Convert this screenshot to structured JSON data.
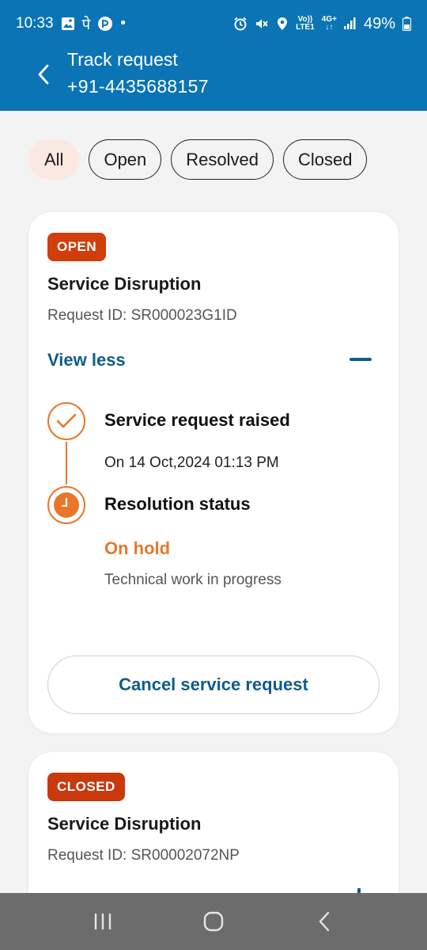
{
  "status_bar": {
    "time": "10:33",
    "pe_glyph": "पे",
    "dot": "•",
    "lte_top": "Vo))",
    "lte_bottom": "LTE1",
    "net_top": "4G+",
    "net_bottom": "↓↑",
    "battery": "49%",
    "icons": [
      "gallery-icon",
      "pe-icon",
      "phonepe-icon",
      "alarm-icon",
      "mute-icon",
      "location-icon",
      "signal-icon",
      "battery-icon"
    ]
  },
  "header": {
    "title": "Track request",
    "subtitle": "+91-4435688157",
    "background": "#0a74b5"
  },
  "filters": [
    {
      "label": "All",
      "active": true
    },
    {
      "label": "Open",
      "active": false
    },
    {
      "label": "Resolved",
      "active": false
    },
    {
      "label": "Closed",
      "active": false
    }
  ],
  "requests": [
    {
      "badge": "OPEN",
      "title": "Service Disruption",
      "request_id": "Request ID: SR000023G1ID",
      "toggle_label": "View less",
      "timeline": [
        {
          "title": "Service request raised",
          "detail": "On 14 Oct,2024 01:13 PM",
          "icon": "check-icon"
        },
        {
          "title": "Resolution status",
          "status": "On hold",
          "detail": "Technical work in progress",
          "icon": "clock-icon"
        }
      ],
      "action": "Cancel service request"
    },
    {
      "badge": "CLOSED",
      "title": "Service Disruption",
      "request_id": "Request ID: SR00002072NP"
    }
  ],
  "colors": {
    "accent_blue": "#0f5c86",
    "accent_orange": "#e8762b",
    "badge_red": "#d13d0b",
    "chip_active_bg": "#fbe9e1"
  }
}
